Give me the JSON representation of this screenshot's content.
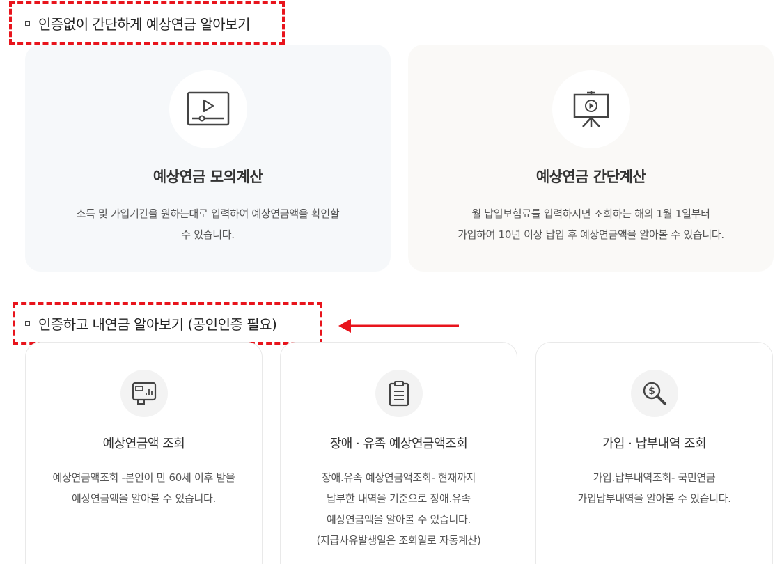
{
  "section1": {
    "title": "인증없이 간단하게 예상연금 알아보기"
  },
  "cards_top": [
    {
      "icon": "video-play-icon",
      "title": "예상연금 모의계산",
      "desc_lines": [
        "소득 및 가입기간을 원하는대로 입력하여 예상연금액을 확인할",
        "수 있습니다."
      ]
    },
    {
      "icon": "presentation-board-icon",
      "title": "예상연금 간단계산",
      "desc_lines": [
        "월 납입보험료를 입력하시면 조회하는 해의 1월 1일부터",
        "가입하여 10년 이상 납입 후 예상연금액을 알아볼 수 있습니다."
      ]
    }
  ],
  "section2": {
    "title": "인증하고 내연금 알아보기 (공인인증 필요)"
  },
  "cards_bottom": [
    {
      "icon": "monitor-chart-icon",
      "title": "예상연금액 조회",
      "desc_lines": [
        "예상연금액조회 -본인이 만 60세 이후 받을",
        "예상연금액을 알아볼 수 있습니다."
      ]
    },
    {
      "icon": "clipboard-list-icon",
      "title": "장애 · 유족 예상연금액조회",
      "desc_lines": [
        "장애.유족 예상연금액조회- 현재까지",
        "납부한 내역을 기준으로 장애.유족",
        "예상연금액을 알아볼 수 있습니다.",
        "(지급사유발생일은 조회일로 자동계산)"
      ]
    },
    {
      "icon": "dollar-search-icon",
      "title": "가입 · 납부내역 조회",
      "desc_lines": [
        "가입.납부내역조회- 국민연금",
        "가입납부내역을 알아볼 수 있습니다."
      ]
    }
  ],
  "colors": {
    "highlight": "#e8141c",
    "arrow": "#e8141c"
  }
}
